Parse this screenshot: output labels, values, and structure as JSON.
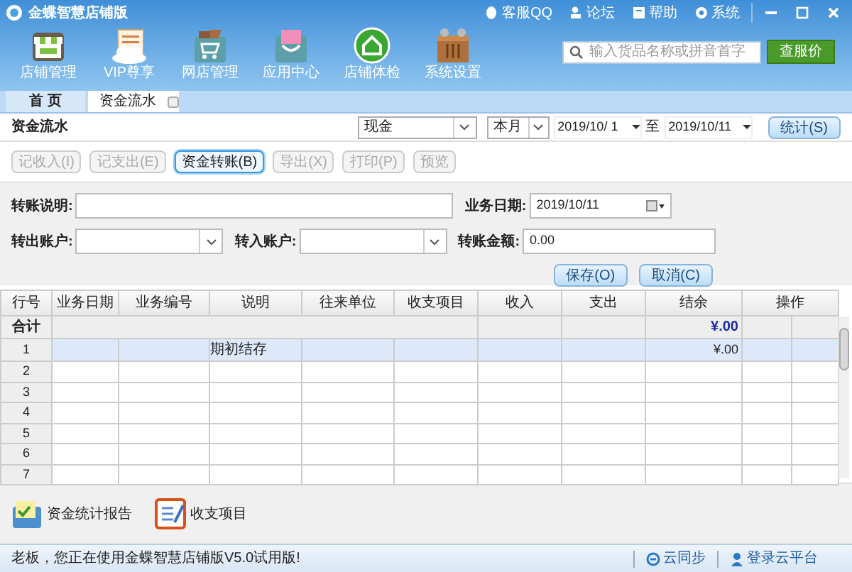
{
  "window": {
    "title": "金蝶智慧店铺版"
  },
  "top_links": [
    {
      "label": "客服QQ",
      "kind": "qq"
    },
    {
      "label": "论坛",
      "kind": "forum"
    },
    {
      "label": "帮助",
      "kind": "help"
    },
    {
      "label": "系统",
      "kind": "settings"
    }
  ],
  "toolbar": [
    {
      "label": "店铺管理",
      "kind": "store"
    },
    {
      "label": "VIP尊享",
      "kind": "vip"
    },
    {
      "label": "网店管理",
      "kind": "cart"
    },
    {
      "label": "应用中心",
      "kind": "apps"
    },
    {
      "label": "店铺体检",
      "kind": "home"
    },
    {
      "label": "系统设置",
      "kind": "crate"
    }
  ],
  "search": {
    "placeholder": "输入货品名称或拼音首字",
    "button": "查服价"
  },
  "tabs": [
    {
      "label": "首 页",
      "selected": false,
      "closable": false
    },
    {
      "label": "资金流水",
      "selected": true,
      "closable": true
    }
  ],
  "page_title": "资金流水",
  "filters": {
    "account": "现金",
    "period": "本月",
    "date_from": "2019/10/ 1",
    "to_label": "至",
    "date_to": "2019/10/11",
    "stats_button": "统计(S)"
  },
  "actions": [
    {
      "label": "记收入(I)",
      "disabled": true,
      "active": false
    },
    {
      "label": "记支出(E)",
      "disabled": true,
      "active": false
    },
    {
      "label": "资金转账(B)",
      "disabled": false,
      "active": true
    },
    {
      "label": "导出(X)",
      "disabled": true,
      "active": false
    },
    {
      "label": "打印(P)",
      "disabled": true,
      "active": false
    },
    {
      "label": "预览",
      "disabled": true,
      "active": false
    }
  ],
  "form": {
    "note_label": "转账说明:",
    "date_label": "业务日期:",
    "date_value": "2019/10/11",
    "from_label": "转出账户:",
    "to_label": "转入账户:",
    "amount_label": "转账金额:",
    "amount_value": "0.00",
    "save_button": "保存(O)",
    "cancel_button": "取消(C)"
  },
  "table": {
    "columns": [
      "行号",
      "业务日期",
      "业务编号",
      "说明",
      "往来单位",
      "收支项目",
      "收入",
      "支出",
      "结余",
      "操作"
    ],
    "total": {
      "label": "合计",
      "balance": "¥.00"
    },
    "rows": [
      {
        "number": "1",
        "selected": true,
        "description": "期初结存",
        "balance": "¥.00"
      },
      {
        "number": "2",
        "selected": false
      },
      {
        "number": "3",
        "selected": false
      },
      {
        "number": "4",
        "selected": false
      },
      {
        "number": "5",
        "selected": false
      },
      {
        "number": "6",
        "selected": false
      },
      {
        "number": "7",
        "selected": false
      }
    ]
  },
  "bottom_links": [
    {
      "label": "资金统计报告",
      "kind": "report"
    },
    {
      "label": "收支项目",
      "kind": "list"
    }
  ],
  "status_bar": {
    "message": "老板，您正在使用金蝶智慧店铺版V5.0试用版!",
    "sync": "云同步",
    "login": "登录云平台"
  }
}
